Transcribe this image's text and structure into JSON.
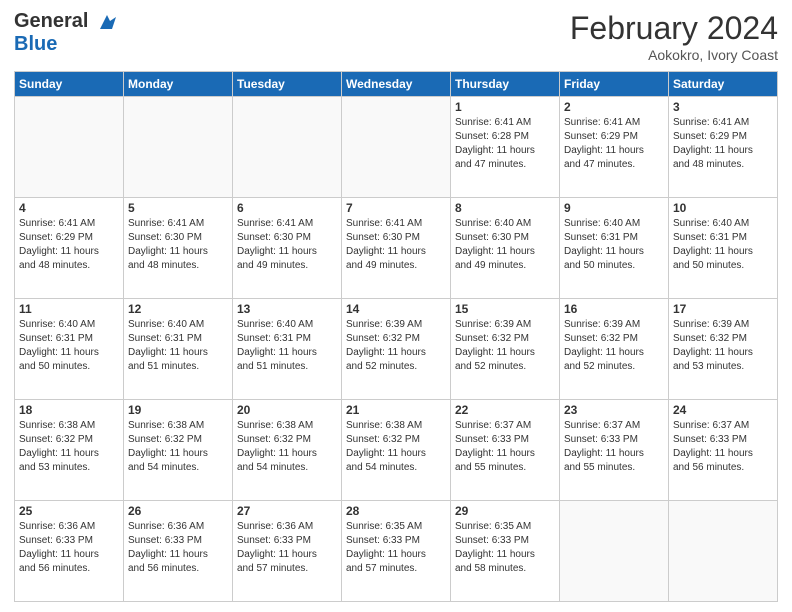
{
  "header": {
    "logo_line1": "General",
    "logo_line2": "Blue",
    "title": "February 2024",
    "subtitle": "Aokokro, Ivory Coast"
  },
  "weekdays": [
    "Sunday",
    "Monday",
    "Tuesday",
    "Wednesday",
    "Thursday",
    "Friday",
    "Saturday"
  ],
  "weeks": [
    [
      {
        "day": "",
        "info": ""
      },
      {
        "day": "",
        "info": ""
      },
      {
        "day": "",
        "info": ""
      },
      {
        "day": "",
        "info": ""
      },
      {
        "day": "1",
        "info": "Sunrise: 6:41 AM\nSunset: 6:28 PM\nDaylight: 11 hours\nand 47 minutes."
      },
      {
        "day": "2",
        "info": "Sunrise: 6:41 AM\nSunset: 6:29 PM\nDaylight: 11 hours\nand 47 minutes."
      },
      {
        "day": "3",
        "info": "Sunrise: 6:41 AM\nSunset: 6:29 PM\nDaylight: 11 hours\nand 48 minutes."
      }
    ],
    [
      {
        "day": "4",
        "info": "Sunrise: 6:41 AM\nSunset: 6:29 PM\nDaylight: 11 hours\nand 48 minutes."
      },
      {
        "day": "5",
        "info": "Sunrise: 6:41 AM\nSunset: 6:30 PM\nDaylight: 11 hours\nand 48 minutes."
      },
      {
        "day": "6",
        "info": "Sunrise: 6:41 AM\nSunset: 6:30 PM\nDaylight: 11 hours\nand 49 minutes."
      },
      {
        "day": "7",
        "info": "Sunrise: 6:41 AM\nSunset: 6:30 PM\nDaylight: 11 hours\nand 49 minutes."
      },
      {
        "day": "8",
        "info": "Sunrise: 6:40 AM\nSunset: 6:30 PM\nDaylight: 11 hours\nand 49 minutes."
      },
      {
        "day": "9",
        "info": "Sunrise: 6:40 AM\nSunset: 6:31 PM\nDaylight: 11 hours\nand 50 minutes."
      },
      {
        "day": "10",
        "info": "Sunrise: 6:40 AM\nSunset: 6:31 PM\nDaylight: 11 hours\nand 50 minutes."
      }
    ],
    [
      {
        "day": "11",
        "info": "Sunrise: 6:40 AM\nSunset: 6:31 PM\nDaylight: 11 hours\nand 50 minutes."
      },
      {
        "day": "12",
        "info": "Sunrise: 6:40 AM\nSunset: 6:31 PM\nDaylight: 11 hours\nand 51 minutes."
      },
      {
        "day": "13",
        "info": "Sunrise: 6:40 AM\nSunset: 6:31 PM\nDaylight: 11 hours\nand 51 minutes."
      },
      {
        "day": "14",
        "info": "Sunrise: 6:39 AM\nSunset: 6:32 PM\nDaylight: 11 hours\nand 52 minutes."
      },
      {
        "day": "15",
        "info": "Sunrise: 6:39 AM\nSunset: 6:32 PM\nDaylight: 11 hours\nand 52 minutes."
      },
      {
        "day": "16",
        "info": "Sunrise: 6:39 AM\nSunset: 6:32 PM\nDaylight: 11 hours\nand 52 minutes."
      },
      {
        "day": "17",
        "info": "Sunrise: 6:39 AM\nSunset: 6:32 PM\nDaylight: 11 hours\nand 53 minutes."
      }
    ],
    [
      {
        "day": "18",
        "info": "Sunrise: 6:38 AM\nSunset: 6:32 PM\nDaylight: 11 hours\nand 53 minutes."
      },
      {
        "day": "19",
        "info": "Sunrise: 6:38 AM\nSunset: 6:32 PM\nDaylight: 11 hours\nand 54 minutes."
      },
      {
        "day": "20",
        "info": "Sunrise: 6:38 AM\nSunset: 6:32 PM\nDaylight: 11 hours\nand 54 minutes."
      },
      {
        "day": "21",
        "info": "Sunrise: 6:38 AM\nSunset: 6:32 PM\nDaylight: 11 hours\nand 54 minutes."
      },
      {
        "day": "22",
        "info": "Sunrise: 6:37 AM\nSunset: 6:33 PM\nDaylight: 11 hours\nand 55 minutes."
      },
      {
        "day": "23",
        "info": "Sunrise: 6:37 AM\nSunset: 6:33 PM\nDaylight: 11 hours\nand 55 minutes."
      },
      {
        "day": "24",
        "info": "Sunrise: 6:37 AM\nSunset: 6:33 PM\nDaylight: 11 hours\nand 56 minutes."
      }
    ],
    [
      {
        "day": "25",
        "info": "Sunrise: 6:36 AM\nSunset: 6:33 PM\nDaylight: 11 hours\nand 56 minutes."
      },
      {
        "day": "26",
        "info": "Sunrise: 6:36 AM\nSunset: 6:33 PM\nDaylight: 11 hours\nand 56 minutes."
      },
      {
        "day": "27",
        "info": "Sunrise: 6:36 AM\nSunset: 6:33 PM\nDaylight: 11 hours\nand 57 minutes."
      },
      {
        "day": "28",
        "info": "Sunrise: 6:35 AM\nSunset: 6:33 PM\nDaylight: 11 hours\nand 57 minutes."
      },
      {
        "day": "29",
        "info": "Sunrise: 6:35 AM\nSunset: 6:33 PM\nDaylight: 11 hours\nand 58 minutes."
      },
      {
        "day": "",
        "info": ""
      },
      {
        "day": "",
        "info": ""
      }
    ]
  ]
}
